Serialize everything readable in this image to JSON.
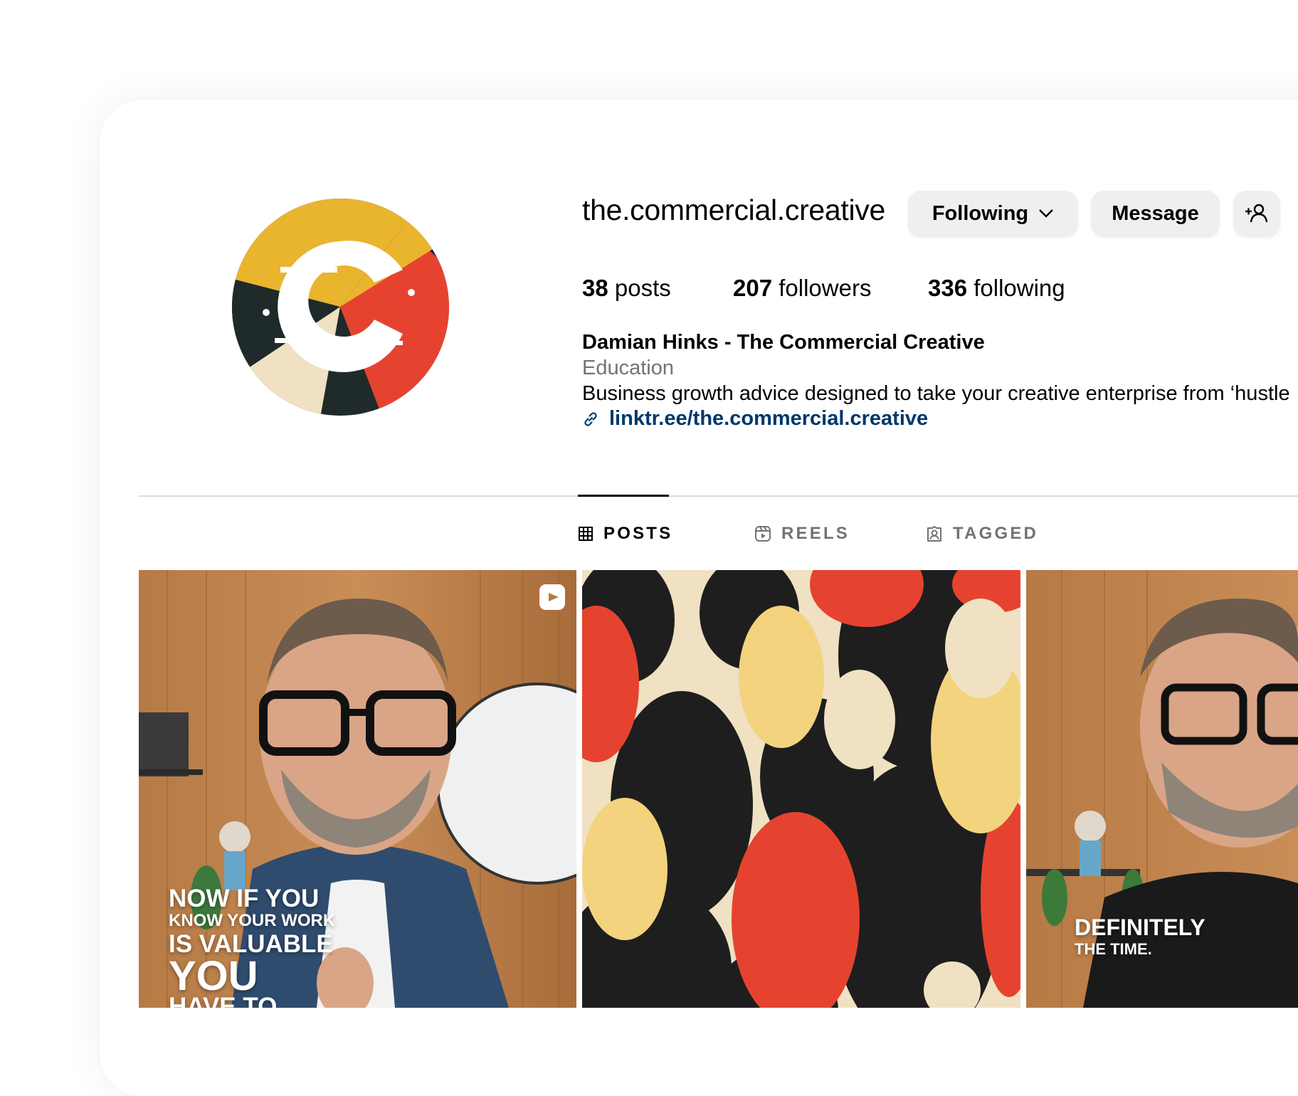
{
  "profile": {
    "username": "the.commercial.creative",
    "following_button": "Following",
    "message_button": "Message",
    "posts_count": "38",
    "posts_label": "posts",
    "followers_count": "207",
    "followers_label": "followers",
    "following_count": "336",
    "following_label": "following",
    "full_name": "Damian Hinks - The Commercial Creative",
    "category": "Education",
    "bio": "Business growth advice designed to take your creative enterprise from ‘hustle",
    "link": "linktr.ee/the.commercial.creative"
  },
  "tabs": [
    {
      "label": "POSTS",
      "icon": "grid-icon",
      "active": true
    },
    {
      "label": "REELS",
      "icon": "reels-icon",
      "active": false
    },
    {
      "label": "TAGGED",
      "icon": "tagged-icon",
      "active": false
    }
  ],
  "posts": [
    {
      "type": "reel",
      "caption_lines": [
        "NOW IF YOU",
        "KNOW YOUR WORK",
        "IS VALUABLE",
        "YOU",
        "HAVE TO"
      ]
    },
    {
      "type": "image"
    },
    {
      "type": "video",
      "caption_lines": [
        "DEFINITELY",
        "THE TIME."
      ]
    }
  ],
  "colors": {
    "link": "#00376b",
    "button_bg": "#efefef",
    "logo_yellow": "#e9b42e",
    "logo_red": "#e5432f",
    "logo_dark": "#1f2a2a",
    "logo_cream": "#efe1c2"
  }
}
